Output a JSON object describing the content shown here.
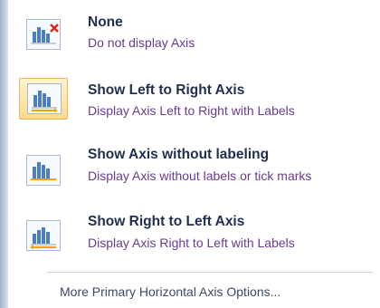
{
  "menu": {
    "items": [
      {
        "title": "None",
        "description": "Do not display Axis",
        "icon": "chart-axis-none-icon"
      },
      {
        "title": "Show Left to Right Axis",
        "description": "Display Axis Left to Right with Labels",
        "icon": "chart-axis-left-to-right-icon",
        "selected": true
      },
      {
        "title": "Show Axis without labeling",
        "description": "Display Axis without labels or tick marks",
        "icon": "chart-axis-no-labels-icon"
      },
      {
        "title": "Show Right to Left Axis",
        "description": "Display Axis Right to Left with Labels",
        "icon": "chart-axis-right-to-left-icon"
      }
    ],
    "more_options": "More Primary Horizontal Axis Options..."
  },
  "colors": {
    "title": "#1f2f4d",
    "description": "#6a3b8f",
    "selected_fill": "#ffd98a",
    "selected_border": "#f2b35b",
    "axis_orange": "#f0a020",
    "delete_red": "#d9261c"
  }
}
